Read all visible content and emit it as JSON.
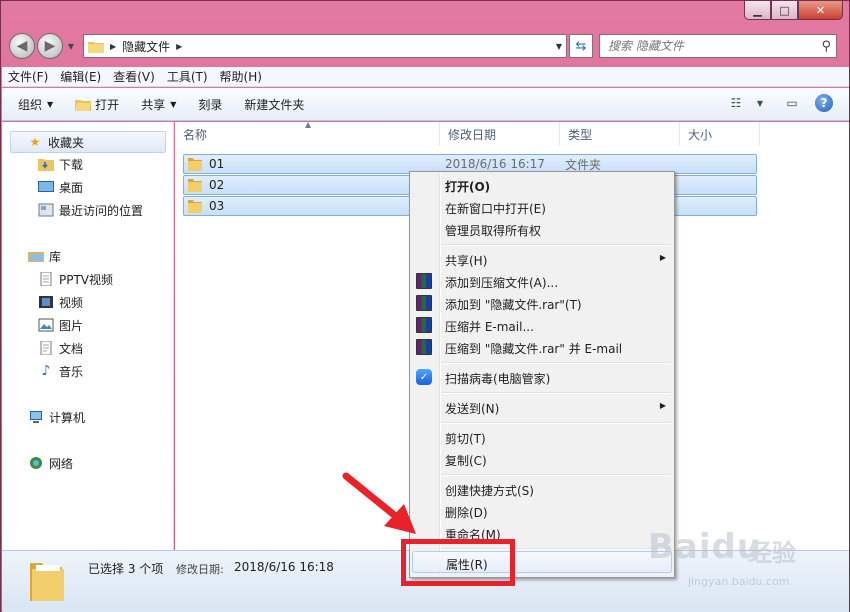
{
  "window": {
    "caption": {
      "minimize": "▁",
      "maximize": "□",
      "close": "✕"
    }
  },
  "address_bar": {
    "back_icon": "back-arrow",
    "forward_icon": "forward-arrow",
    "breadcrumb": [
      "隐藏文件"
    ],
    "search_placeholder": "搜索 隐藏文件"
  },
  "menubar": {
    "items": [
      "文件(F)",
      "编辑(E)",
      "查看(V)",
      "工具(T)",
      "帮助(H)"
    ]
  },
  "commandbar": {
    "organize": "组织",
    "open": "打开",
    "share": "共享",
    "burn": "刻录",
    "new_folder": "新建文件夹"
  },
  "navpane": {
    "favorites": "收藏夹",
    "downloads": "下载",
    "desktop": "桌面",
    "recent": "最近访问的位置",
    "libraries": "库",
    "pptv": "PPTV视频",
    "videos": "视频",
    "pictures": "图片",
    "documents": "文档",
    "music": "音乐",
    "computer": "计算机",
    "network": "网络"
  },
  "columns": {
    "name": "名称",
    "date": "修改日期",
    "type": "类型",
    "size": "大小"
  },
  "files": [
    {
      "name": "01",
      "date": "2018/6/16 16:17",
      "type": "文件夹"
    },
    {
      "name": "02",
      "date": "",
      "type": ""
    },
    {
      "name": "03",
      "date": "",
      "type": ""
    }
  ],
  "context_menu": {
    "open": "打开(O)",
    "open_new_window": "在新窗口中打开(E)",
    "take_ownership": "管理员取得所有权",
    "share": "共享(H)",
    "add_archive": "添加到压缩文件(A)...",
    "add_rar": "添加到 \"隐藏文件.rar\"(T)",
    "compress_email": "压缩并 E-mail...",
    "compress_rar_email": "压缩到 \"隐藏文件.rar\" 并 E-mail",
    "scan_virus": "扫描病毒(电脑管家)",
    "send_to": "发送到(N)",
    "cut": "剪切(T)",
    "copy": "复制(C)",
    "create_shortcut": "创建快捷方式(S)",
    "delete": "删除(D)",
    "rename": "重命名(M)",
    "properties": "属性(R)"
  },
  "statusbar": {
    "selected": "已选择 3 个项",
    "date_label": "修改日期:",
    "date_value": "2018/6/16 16:18"
  },
  "watermark": {
    "brand": "Baidu",
    "suffix": "经验",
    "site": "jingyan.baidu.com"
  },
  "colors": {
    "titlebar": "#d9688f",
    "highlight_box": "#e8212b",
    "selection": "#c7e0f9"
  }
}
